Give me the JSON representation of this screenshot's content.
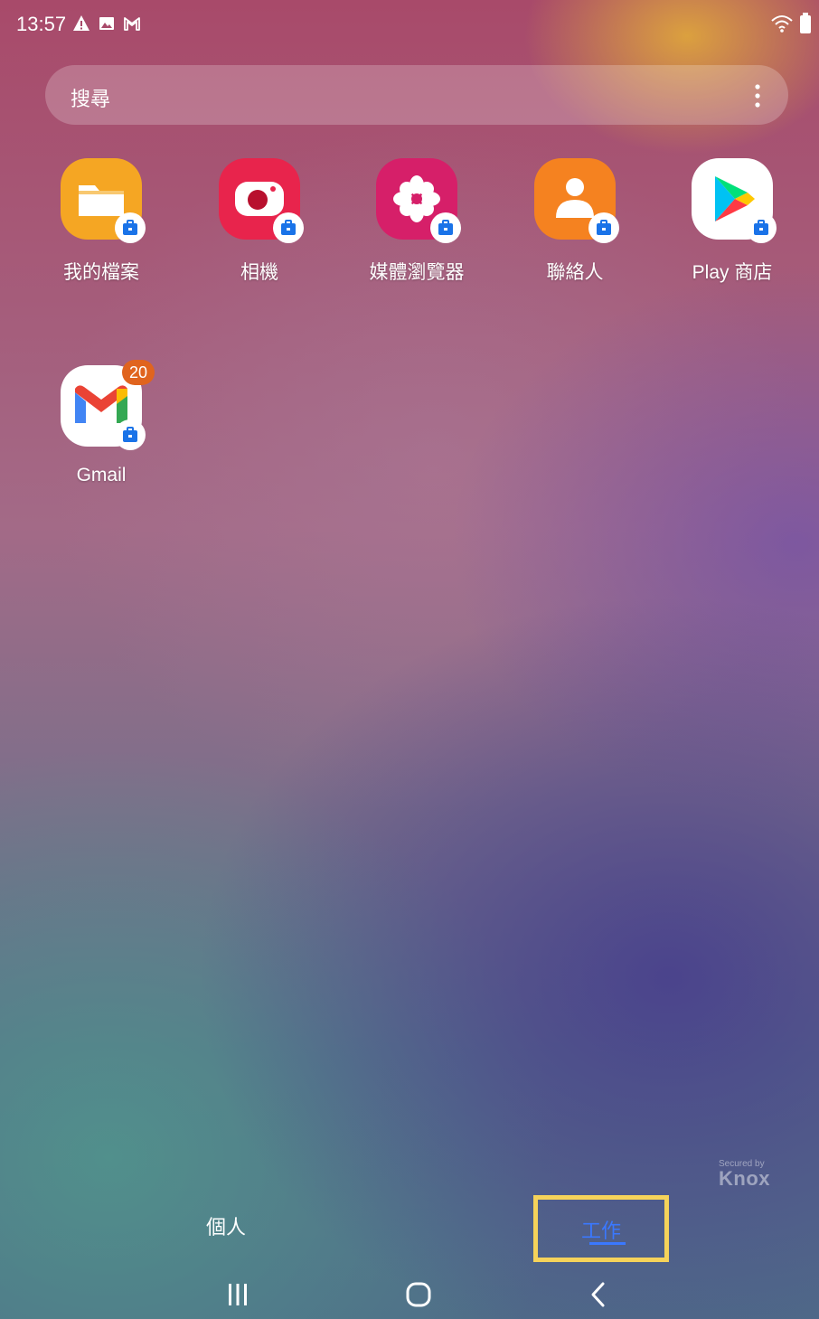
{
  "status_bar": {
    "time": "13:57",
    "left_icons": [
      "warning-icon",
      "image-icon",
      "gmail-notification-icon"
    ],
    "right_icons": [
      "wifi-icon",
      "battery-icon"
    ]
  },
  "search": {
    "label": "搜尋",
    "menu_icon": "more-vert-icon"
  },
  "apps": [
    {
      "label": "我的檔案",
      "icon": "my-files-icon",
      "work_profile": true
    },
    {
      "label": "相機",
      "icon": "camera-icon",
      "work_profile": true
    },
    {
      "label": "媒體瀏覽器",
      "icon": "media-browser-icon",
      "work_profile": true
    },
    {
      "label": "聯絡人",
      "icon": "contacts-icon",
      "work_profile": true
    },
    {
      "label": "Play 商店",
      "icon": "play-store-icon",
      "work_profile": true
    },
    {
      "label": "Gmail",
      "icon": "gmail-icon",
      "work_profile": true,
      "badge_count": "20"
    }
  ],
  "knox": {
    "small": "Secured by",
    "big": "Knox"
  },
  "tabs": {
    "personal": "個人",
    "work": "工作",
    "selected": "work"
  },
  "nav": [
    "recents-icon",
    "home-icon",
    "back-icon"
  ],
  "colors": {
    "accent": "#3a78ff",
    "highlight_box": "#f6d35a",
    "badge": "#e0641e",
    "my_files": "#f5a623",
    "camera": "#e8244c",
    "media": "#d61f69",
    "contacts": "#f58220"
  }
}
